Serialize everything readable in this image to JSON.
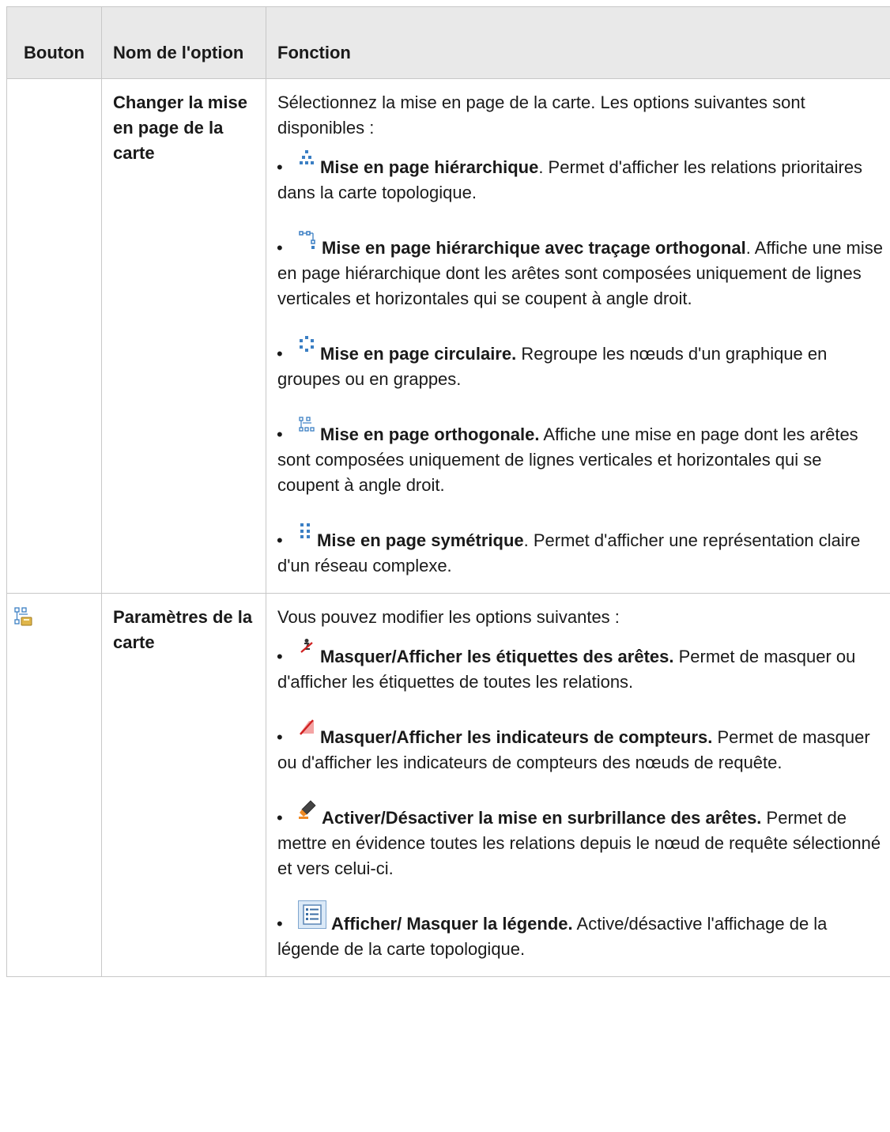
{
  "table": {
    "headers": {
      "bouton": "Bouton",
      "nom": "Nom de l'option",
      "fonction": "Fonction"
    },
    "rows": [
      {
        "bouton_icon": "",
        "nom": "Changer la mise en page de la carte",
        "intro": "Sélectionnez la mise en page de la carte. Les options suivantes sont disponibles :",
        "options": [
          {
            "icon": "hierarchical-layout-icon",
            "title": "Mise en page hiérarchique",
            "text": ". Permet d'afficher les relations prioritaires dans la carte topologique."
          },
          {
            "icon": "hierarchical-orthogonal-layout-icon",
            "title": "Mise en page hiérarchique avec traçage orthogonal",
            "text": ". Affiche une mise en page hiérarchique dont les arêtes sont composées uniquement de lignes verticales et horizontales qui se coupent à angle droit."
          },
          {
            "icon": "circular-layout-icon",
            "title": "Mise en page circulaire.",
            "text": " Regroupe les nœuds d'un graphique en groupes ou en grappes."
          },
          {
            "icon": "orthogonal-layout-icon",
            "title": "Mise en page orthogonale.",
            "text": " Affiche une mise en page dont les arêtes sont composées uniquement de lignes verticales et horizontales qui se coupent à angle droit."
          },
          {
            "icon": "symmetric-layout-icon",
            "title": "Mise en page symétrique",
            "text": ". Permet d'afficher une représentation claire d'un réseau complexe."
          }
        ]
      },
      {
        "bouton_icon": "map-settings-icon",
        "nom": "Paramètres de la carte",
        "intro": "Vous pouvez modifier les options suivantes :",
        "options": [
          {
            "icon": "edge-labels-icon",
            "title": "Masquer/Afficher les étiquettes des arêtes.",
            "text": " Permet de masquer ou d'afficher les étiquettes de toutes les relations."
          },
          {
            "icon": "counter-indicators-icon",
            "title": "Masquer/Afficher les indicateurs de compteurs.",
            "text": " Permet de masquer ou d'afficher les indicateurs de compteurs des nœuds de requête."
          },
          {
            "icon": "highlight-edges-icon",
            "title": "Activer/Désactiver la mise en surbrillance des arêtes.",
            "text": " Permet de mettre en évidence toutes les relations depuis le nœud de requête sélectionné et vers celui-ci."
          },
          {
            "icon": "legend-icon",
            "title": "Afficher/ Masquer la légende.",
            "text": " Active/désactive l'affichage de la légende de la carte topologique."
          }
        ]
      }
    ]
  }
}
